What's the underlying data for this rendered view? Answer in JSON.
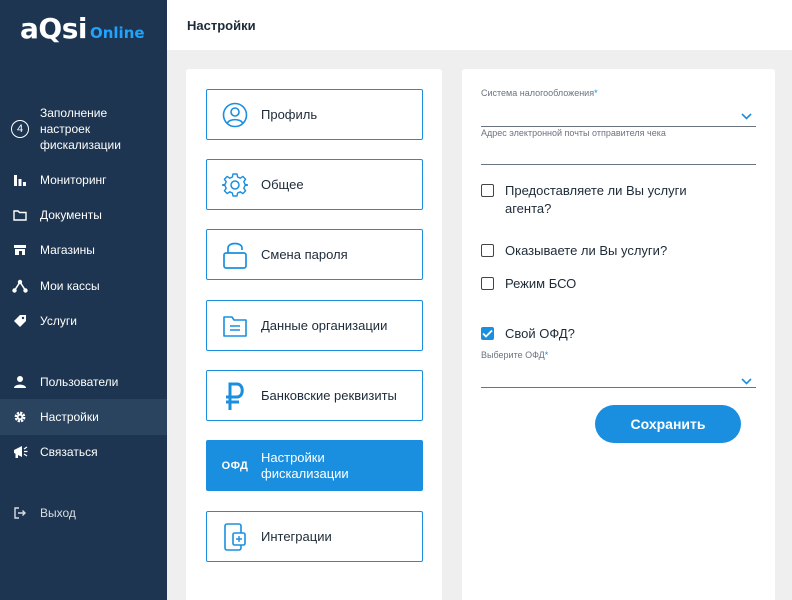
{
  "logo": {
    "main_a": "a",
    "main_q": "Q",
    "main_si": "si",
    "online": "Online"
  },
  "sidebar": {
    "items": [
      {
        "label": "Заполнение настроек фискализации",
        "step": "4",
        "icon": "step-circle"
      },
      {
        "label": "Мониторинг",
        "icon": "bar-chart-icon"
      },
      {
        "label": "Документы",
        "icon": "folder-icon"
      },
      {
        "label": "Магазины",
        "icon": "store-icon"
      },
      {
        "label": "Мои кассы",
        "icon": "network-icon"
      },
      {
        "label": "Услуги",
        "icon": "tag-icon"
      },
      {
        "label": "Пользователи",
        "icon": "user-icon"
      },
      {
        "label": "Настройки",
        "icon": "gear-icon",
        "active": true
      },
      {
        "label": "Связаться",
        "icon": "megaphone-icon"
      },
      {
        "label": "Выход",
        "icon": "logout-icon"
      }
    ]
  },
  "header": {
    "title": "Настройки"
  },
  "menu": {
    "cards": [
      {
        "label": "Профиль",
        "icon": "profile-icon"
      },
      {
        "label": "Общее",
        "icon": "gear-icon"
      },
      {
        "label": "Смена пароля",
        "icon": "lock-icon"
      },
      {
        "label": "Данные организации",
        "icon": "folder-doc-icon"
      },
      {
        "label": "Банковские реквизиты",
        "icon": "ruble-icon"
      },
      {
        "label": "Настройки фискализации",
        "icon": "ofd-icon",
        "icon_text": "ОФД",
        "active": true
      },
      {
        "label": "Интеграции",
        "icon": "device-sync-icon"
      }
    ]
  },
  "form": {
    "tax_system_label": "Система налогообложения",
    "required_mark": "*",
    "email_label": "Адрес электронной почты отправителя чека",
    "agent_question": "Предоставляете ли Вы услуги агента?",
    "agent_checked": false,
    "services_question": "Оказываете ли Вы услуги?",
    "services_checked": false,
    "bso_label": "Режим БСО",
    "bso_checked": false,
    "own_ofd_label": "Свой ОФД?",
    "own_ofd_checked": true,
    "choose_ofd_label": "Выберите ОФД",
    "save_label": "Сохранить"
  },
  "colors": {
    "sidebar_bg": "#1d3550",
    "accent": "#1a8fe0",
    "logo_online": "#1fa3ff",
    "page_bg": "#efefef"
  }
}
